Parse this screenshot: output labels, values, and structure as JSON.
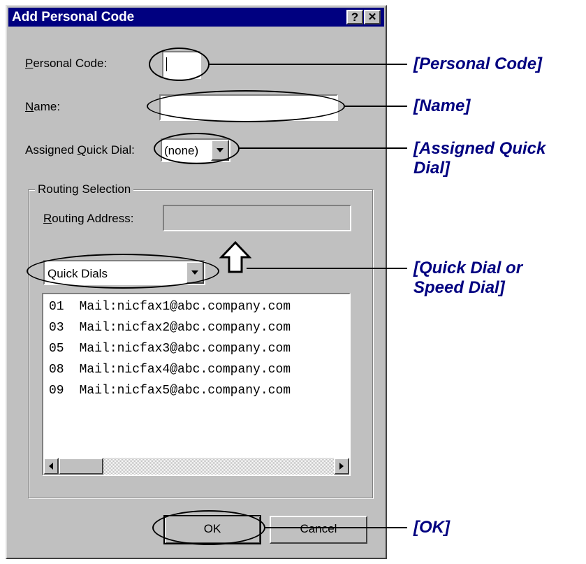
{
  "dialog": {
    "title": "Add Personal Code",
    "help_label": "?",
    "close_label": "✕"
  },
  "fields": {
    "personal_code_label_u": "P",
    "personal_code_label_rest": "ersonal Code:",
    "personal_code_value": "",
    "name_label_u": "N",
    "name_label_rest": "ame:",
    "name_value": "",
    "quick_dial_label_pre": "Assigned ",
    "quick_dial_label_u": "Q",
    "quick_dial_label_rest": "uick Dial:",
    "quick_dial_value": "(none)"
  },
  "routing": {
    "group_label": "Routing Selection",
    "address_label_u": "R",
    "address_label_rest": "outing Address:",
    "address_value": "",
    "source_value": "Quick Dials",
    "entries": [
      {
        "num": "01",
        "address": "Mail:nicfax1@abc.company.com"
      },
      {
        "num": "03",
        "address": "Mail:nicfax2@abc.company.com"
      },
      {
        "num": "05",
        "address": "Mail:nicfax3@abc.company.com"
      },
      {
        "num": "08",
        "address": "Mail:nicfax4@abc.company.com"
      },
      {
        "num": "09",
        "address": "Mail:nicfax5@abc.company.com"
      }
    ]
  },
  "buttons": {
    "ok_label": "OK",
    "cancel_label": "Cancel"
  },
  "callouts": {
    "personal_code": "[Personal Code]",
    "name": "[Name]",
    "quick_dial_line1": "[Assigned Quick",
    "quick_dial_line2": "Dial]",
    "list_line1": "[Quick Dial or",
    "list_line2": "Speed Dial]",
    "ok": "[OK]"
  },
  "colors": {
    "title_bar": "#000080",
    "callout_text": "#000080",
    "dialog_face": "#c0c0c0"
  },
  "icons": {
    "transfer": "up-arrow-icon",
    "dropdown": "chevron-down-icon"
  }
}
